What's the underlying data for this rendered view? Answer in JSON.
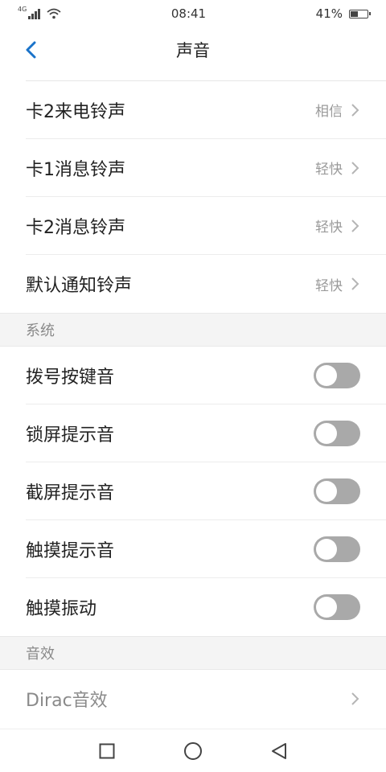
{
  "status_bar": {
    "network": "4G",
    "time": "08:41",
    "battery_percent": "41%",
    "battery_level": 0.41
  },
  "header": {
    "title": "声音"
  },
  "ringtones": [
    {
      "label": "卡2来电铃声",
      "value": "相信"
    },
    {
      "label": "卡1消息铃声",
      "value": "轻快"
    },
    {
      "label": "卡2消息铃声",
      "value": "轻快"
    },
    {
      "label": "默认通知铃声",
      "value": "轻快"
    }
  ],
  "system": {
    "header": "系统",
    "items": [
      {
        "label": "拨号按键音",
        "on": false
      },
      {
        "label": "锁屏提示音",
        "on": false
      },
      {
        "label": "截屏提示音",
        "on": false
      },
      {
        "label": "触摸提示音",
        "on": false
      },
      {
        "label": "触摸振动",
        "on": false
      }
    ]
  },
  "effects": {
    "header": "音效",
    "items": [
      {
        "label": "Dirac音效"
      }
    ]
  },
  "colors": {
    "accent": "#1a73c9",
    "toggle_off": "#a9a9a9"
  }
}
